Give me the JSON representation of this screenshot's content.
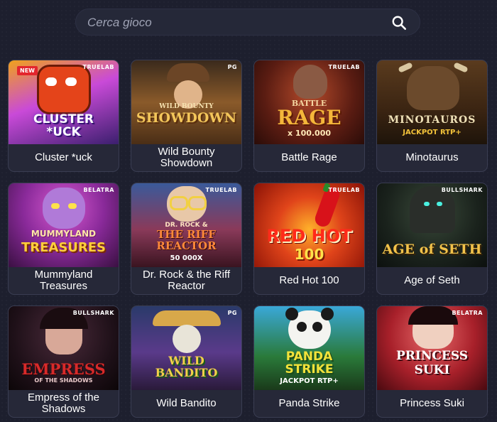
{
  "search": {
    "placeholder": "Cerca gioco",
    "icon": "search-icon"
  },
  "games": [
    {
      "title": "Cluster *uck",
      "art": "CLUSTER *UCK",
      "provider": "TRUELAB",
      "badge": "NEW"
    },
    {
      "title": "Wild Bounty Showdown",
      "art": "SHOWDOWN",
      "art_top": "WILD BOUNTY",
      "provider": "PG"
    },
    {
      "title": "Battle Rage",
      "art": "RAGE",
      "art_top": "BATTLE",
      "art_sub": "x 100.000",
      "provider": "TRUELAB"
    },
    {
      "title": "Minotaurus",
      "art": "MINOTAUROS",
      "art_sub": "JACKPOT RTP+",
      "provider": ""
    },
    {
      "title": "Mummyland Treasures",
      "art": "TREASURES",
      "art_top": "MUMMYLAND",
      "provider": "BELATRA"
    },
    {
      "title": "Dr. Rock & the Riff Reactor",
      "art": "THE RIFF REACTOR",
      "art_top": "DR. ROCK &",
      "art_sub": "50 000X",
      "provider": "TRUELAB"
    },
    {
      "title": "Red Hot 100",
      "art": "RED HOT",
      "art_sub": "100",
      "provider": "TRUELAB"
    },
    {
      "title": "Age of Seth",
      "art": "AGE of SETH",
      "provider": "BULLSHARK"
    },
    {
      "title": "Empress of the Shadows",
      "art": "EMPRESS",
      "art_sub": "OF THE SHADOWS",
      "provider": "BULLSHARK"
    },
    {
      "title": "Wild Bandito",
      "art": "WILD BANDITO",
      "provider": "PG"
    },
    {
      "title": "Panda Strike",
      "art": "PANDA STRIKE",
      "art_sub": "JACKPOT RTP+",
      "provider": ""
    },
    {
      "title": "Princess Suki",
      "art": "PRINCESS SUKI",
      "provider": "BELATRA"
    }
  ]
}
